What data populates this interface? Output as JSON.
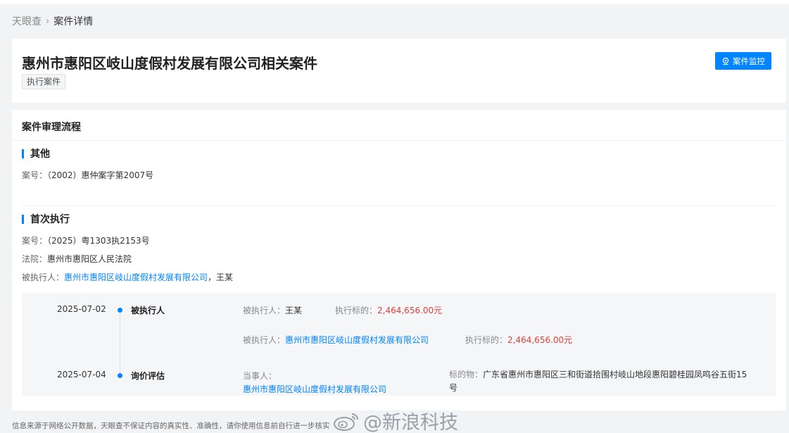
{
  "breadcrumb": {
    "home": "天眼查",
    "separator": "›",
    "current": "案件详情"
  },
  "header": {
    "title": "惠州市惠阳区岐山度假村发展有限公司相关案件",
    "tag": "执行案件",
    "monitor_button": "案件监控"
  },
  "process": {
    "title": "案件审理流程",
    "other": {
      "title": "其他",
      "case_no_label": "案号：",
      "case_no": "（2002）惠仲案字第2007号"
    },
    "first_exec": {
      "title": "首次执行",
      "case_no_label": "案号：",
      "case_no": "（2025）粤1303执2153号",
      "court_label": "法院：",
      "court": "惠州市惠阳区人民法院",
      "respondent_label": "被执行人：",
      "respondent_company": "惠州市惠阳区岐山度假村发展有限公司",
      "respondent_sep": "，",
      "respondent_person": "王某"
    },
    "timeline": [
      {
        "date": "2025-07-02",
        "type": "被执行人",
        "rows": [
          {
            "person_label": "被执行人：",
            "person": "王某",
            "amount_label": "执行标的：",
            "amount": "2,464,656.00元"
          },
          {
            "person_label": "被执行人：",
            "person": "惠州市惠阳区岐山度假村发展有限公司",
            "amount_label": "执行标的：",
            "amount": "2,464,656.00元"
          }
        ]
      },
      {
        "date": "2025-07-04",
        "type": "询价评估",
        "party_label": "当事人：",
        "party": "惠州市惠阳区岐山度假村发展有限公司",
        "object_label": "标的物：",
        "object": "广东省惠州市惠阳区三和街道拾围村岐山地段惠阳碧桂园凤鸣谷五街15号"
      }
    ]
  },
  "footer": "信息来源于网络公开数据，天眼查不保证内容的真实性、准确性，请你使用信息前自行进一步核实",
  "watermark": "@新浪科技",
  "colors": {
    "accent": "#0084ff",
    "amount": "#e5403a",
    "background": "#f2f3f5"
  }
}
